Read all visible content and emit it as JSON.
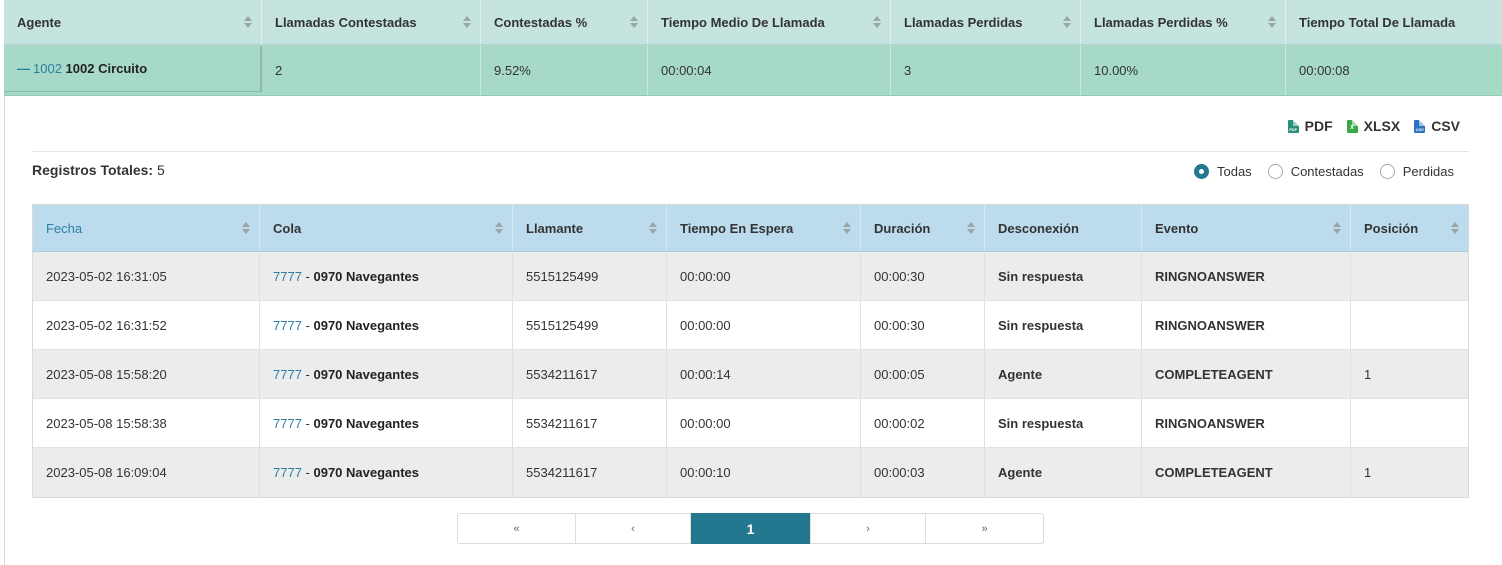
{
  "agent_table": {
    "headers": [
      "Agente",
      "Llamadas Contestadas",
      "Contestadas %",
      "Tiempo Medio De Llamada",
      "Llamadas Perdidas",
      "Llamadas Perdidas %",
      "Tiempo Total De Llamada"
    ],
    "row": {
      "collapse_symbol": "—",
      "agent_code": "1002",
      "agent_name": "1002 Circuito",
      "answered": "2",
      "answered_pct": "9.52%",
      "avg_time": "00:00:04",
      "lost": "3",
      "lost_pct": "10.00%",
      "total_time": "00:00:08"
    }
  },
  "exports": [
    {
      "label": "PDF",
      "icon": "pdf-file-icon",
      "color": "#2a8f7c",
      "tag": "PDF"
    },
    {
      "label": "XLSX",
      "icon": "excel-file-icon",
      "color": "#3aa845",
      "tag": "x"
    },
    {
      "label": "CSV",
      "icon": "csv-file-icon",
      "color": "#2f74c0",
      "tag": "CSV"
    }
  ],
  "totals": {
    "label": "Registros Totales:",
    "value": "5"
  },
  "filters": [
    {
      "label": "Todas",
      "selected": true
    },
    {
      "label": "Contestadas",
      "selected": false
    },
    {
      "label": "Perdidas",
      "selected": false
    }
  ],
  "records": {
    "headers": [
      "Fecha",
      "Cola",
      "Llamante",
      "Tiempo En Espera",
      "Duración",
      "Desconexión",
      "Evento",
      "Posición"
    ],
    "rows": [
      {
        "fecha": "2023-05-02 16:31:05",
        "cola_code": "7777",
        "cola_sep": " - ",
        "cola_name": "0970 Navegantes",
        "llamante": "5515125499",
        "espera": "00:00:00",
        "duracion": "00:00:30",
        "desconexion": "Sin respuesta",
        "evento": "RINGNOANSWER",
        "posicion": ""
      },
      {
        "fecha": "2023-05-02 16:31:52",
        "cola_code": "7777",
        "cola_sep": " - ",
        "cola_name": "0970 Navegantes",
        "llamante": "5515125499",
        "espera": "00:00:00",
        "duracion": "00:00:30",
        "desconexion": "Sin respuesta",
        "evento": "RINGNOANSWER",
        "posicion": ""
      },
      {
        "fecha": "2023-05-08 15:58:20",
        "cola_code": "7777",
        "cola_sep": " - ",
        "cola_name": "0970 Navegantes",
        "llamante": "5534211617",
        "espera": "00:00:14",
        "duracion": "00:00:05",
        "desconexion": "Agente",
        "evento": "COMPLETEAGENT",
        "posicion": "1"
      },
      {
        "fecha": "2023-05-08 15:58:38",
        "cola_code": "7777",
        "cola_sep": " - ",
        "cola_name": "0970 Navegantes",
        "llamante": "5534211617",
        "espera": "00:00:00",
        "duracion": "00:00:02",
        "desconexion": "Sin respuesta",
        "evento": "RINGNOANSWER",
        "posicion": ""
      },
      {
        "fecha": "2023-05-08 16:09:04",
        "cola_code": "7777",
        "cola_sep": " - ",
        "cola_name": "0970 Navegantes",
        "llamante": "5534211617",
        "espera": "00:00:10",
        "duracion": "00:00:03",
        "desconexion": "Agente",
        "evento": "COMPLETEAGENT",
        "posicion": "1"
      }
    ]
  },
  "pagination": {
    "first": "«",
    "prev": "‹",
    "current": "1",
    "next": "›",
    "last": "»"
  },
  "colors": {
    "accent": "#23788f",
    "link": "#2b7fa6",
    "event_red": "#d9342b",
    "agent_row": "#a6dac6",
    "agent_header": "#c5e3df",
    "records_header": "#bcdcee"
  }
}
